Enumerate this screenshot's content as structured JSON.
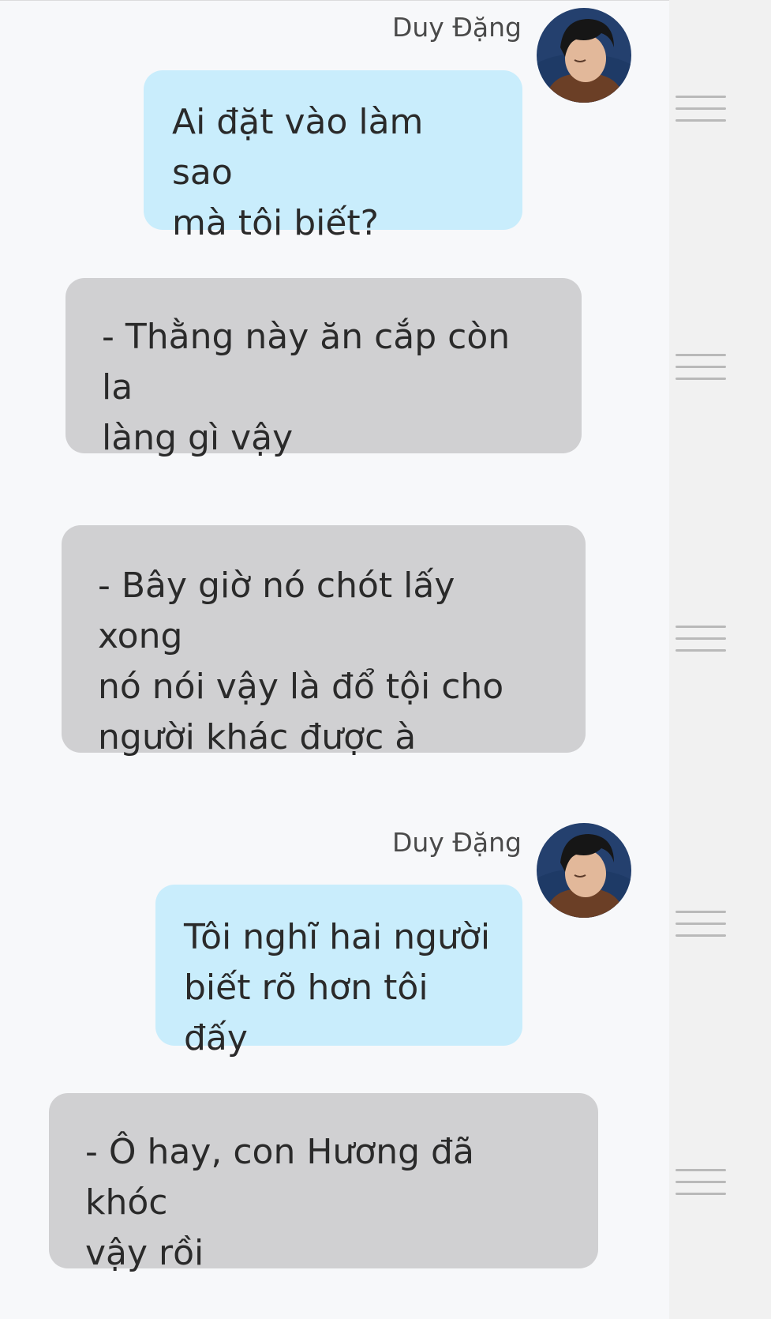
{
  "chat": {
    "messages": [
      {
        "sender": "Duy Đặng",
        "direction": "outgoing",
        "text": "Ai đặt vào làm sao\nmà tôi biết?"
      },
      {
        "sender": "",
        "direction": "incoming",
        "text": "- Thằng này ăn cắp còn la\nlàng gì vậy"
      },
      {
        "sender": "",
        "direction": "incoming",
        "text": "- Bây giờ nó chót lấy xong\nnó nói vậy là đổ tội cho\nngười khác được à"
      },
      {
        "sender": "Duy Đặng",
        "direction": "outgoing",
        "text": "Tôi nghĩ hai người\nbiết rõ hơn tôi đấy"
      },
      {
        "sender": "",
        "direction": "incoming",
        "text": "- Ô hay, con Hương đã khóc\nvậy rồi"
      }
    ]
  },
  "icons": {
    "menu": "hamburger-menu-icon",
    "avatar": "user-avatar-photo"
  },
  "colors": {
    "background": "#f7f8fa",
    "side_panel": "#f1f1f1",
    "outgoing_bubble": "#c9edfc",
    "incoming_bubble": "#d0d0d2",
    "text": "#2a2a2a",
    "sender_name": "#4a4a4a",
    "menu_lines": "#b9b9b9"
  }
}
